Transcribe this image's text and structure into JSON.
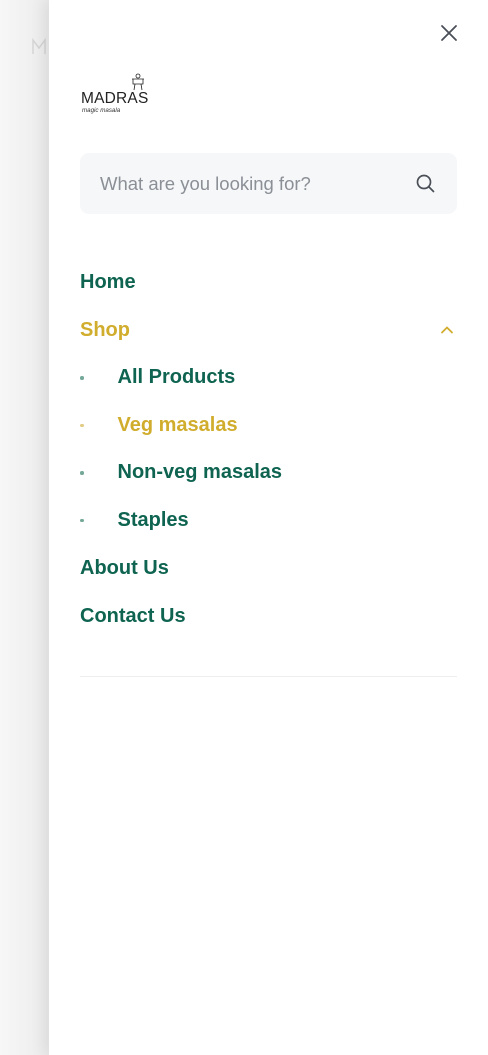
{
  "brand": {
    "logo_text": "MADRAS",
    "logo_tagline": "magic masala"
  },
  "search": {
    "placeholder": "What are you looking for?",
    "value": ""
  },
  "nav": {
    "home": "Home",
    "shop": "Shop",
    "shop_expanded": true,
    "shop_submenu": [
      {
        "label": "All Products",
        "active": false
      },
      {
        "label": "Veg masalas",
        "active": true
      },
      {
        "label": "Non-veg masalas",
        "active": false
      },
      {
        "label": "Staples",
        "active": false
      }
    ],
    "about": "About Us",
    "contact": "Contact Us"
  },
  "colors": {
    "primary_green": "#0e6450",
    "accent_gold": "#d1ad2d",
    "search_bg": "#f6f7f9",
    "placeholder_gray": "#8b8f96"
  },
  "icons": [
    "close-icon",
    "search-icon",
    "chevron-up-icon"
  ]
}
